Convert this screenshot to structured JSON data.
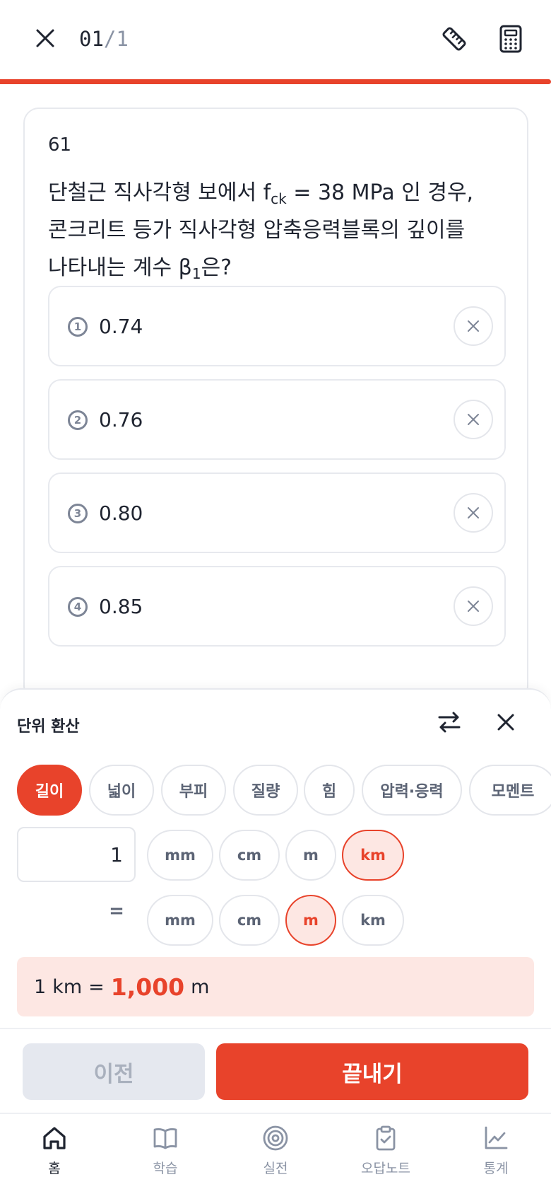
{
  "header": {
    "current": "01",
    "separator": "/",
    "total": "1",
    "progress": 1.0
  },
  "question": {
    "number": "61",
    "line1_a": "단철근 직사각형 보에서 f",
    "line1_sub": "ck",
    "line1_b": " = 38 MPa 인 경우,",
    "line2": "콘크리트 등가 직사각형 압축응력블록의 깊이를",
    "line3_a": "나타내는 계수 β",
    "line3_sub": "1",
    "line3_b": "은?",
    "options": [
      {
        "num": "1",
        "text": "0.74"
      },
      {
        "num": "2",
        "text": "0.76"
      },
      {
        "num": "3",
        "text": "0.80"
      },
      {
        "num": "4",
        "text": "0.85"
      }
    ]
  },
  "converter": {
    "title": "단위 환산",
    "categories": [
      "길이",
      "넓이",
      "부피",
      "질량",
      "힘",
      "압력·응력",
      "모멘트"
    ],
    "active_category": "길이",
    "input_value": "1",
    "from_units": [
      "mm",
      "cm",
      "m",
      "km"
    ],
    "from_active": "km",
    "equals": "=",
    "to_units": [
      "mm",
      "cm",
      "m",
      "km"
    ],
    "to_active": "m",
    "result": {
      "lhs_value": "1",
      "lhs_unit": "km",
      "eq": "=",
      "value": "1,000",
      "unit": "m"
    }
  },
  "actions": {
    "prev_label": "이전",
    "finish_label": "끝내기"
  },
  "nav": {
    "items": [
      {
        "label": "홈",
        "icon": "home-icon"
      },
      {
        "label": "학습",
        "icon": "book-icon"
      },
      {
        "label": "실전",
        "icon": "target-icon"
      },
      {
        "label": "오답노트",
        "icon": "clipboard-check-icon"
      },
      {
        "label": "통계",
        "icon": "chart-line-icon"
      }
    ],
    "active": "홈"
  },
  "colors": {
    "accent": "#e8432b",
    "accent_soft": "#fde7e3",
    "muted": "#8a93a4",
    "border": "#e7e9ee"
  }
}
